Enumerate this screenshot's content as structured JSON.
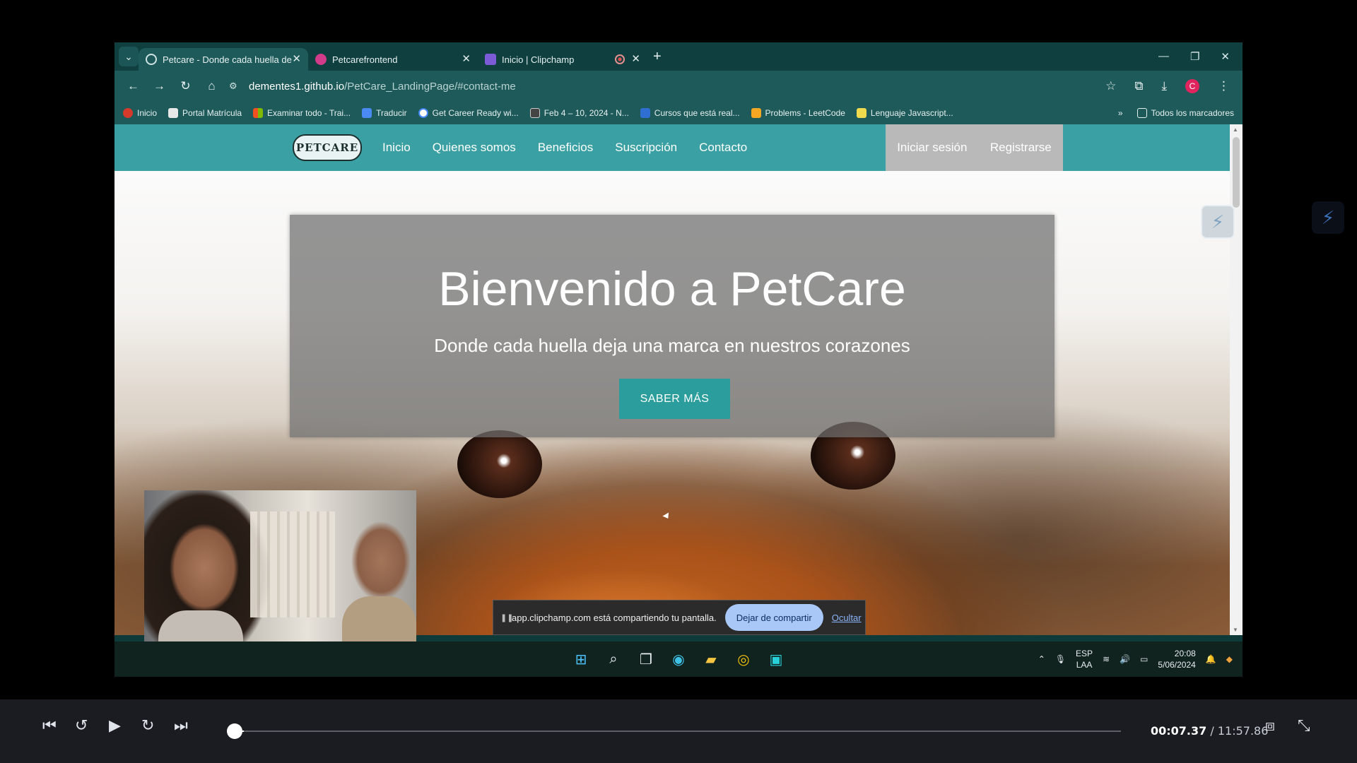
{
  "browser": {
    "tabs": [
      {
        "title": "Petcare - Donde cada huella de",
        "active": true
      },
      {
        "title": "Petcarefrontend",
        "active": false
      },
      {
        "title": "Inicio | Clipchamp",
        "active": false
      }
    ],
    "url_host": "dementes1.github.io",
    "url_path": "/PetCare_LandingPage/#contact-me",
    "profile_initial": "C",
    "bookmarks": [
      "Inicio",
      "Portal Matrícula",
      "Examinar todo - Trai...",
      "Traducir",
      "Get Career Ready wi...",
      "Feb 4 – 10, 2024 - N...",
      "Cursos que está real...",
      "Problems - LeetCode",
      "Lenguaje Javascript..."
    ],
    "all_bookmarks_label": "Todos los marcadores"
  },
  "site": {
    "logo_text": "PETCARE",
    "nav": [
      "Inicio",
      "Quienes somos",
      "Beneficios",
      "Suscripción",
      "Contacto"
    ],
    "login": "Iniciar sesión",
    "register": "Registrarse",
    "hero_title": "Bienvenido a PetCare",
    "hero_subtitle": "Donde cada huella deja una marca en nuestros corazones",
    "hero_button": "SABER MÁS"
  },
  "share_bar": {
    "message": "app.clipchamp.com está compartiendo tu pantalla.",
    "stop_label": "Dejar de compartir",
    "hide_label": "Ocultar"
  },
  "taskbar": {
    "lang_line1": "ESP",
    "lang_line2": "LAA",
    "time": "20:08",
    "date": "5/06/2024"
  },
  "player": {
    "current_time": "00:07.37",
    "total_time": "11:57.86",
    "progress": 0.0106
  },
  "colors": {
    "nav_teal": "#3aa0a3",
    "button_teal": "#2a9d9c",
    "browser_chrome": "#1e5a5a"
  }
}
